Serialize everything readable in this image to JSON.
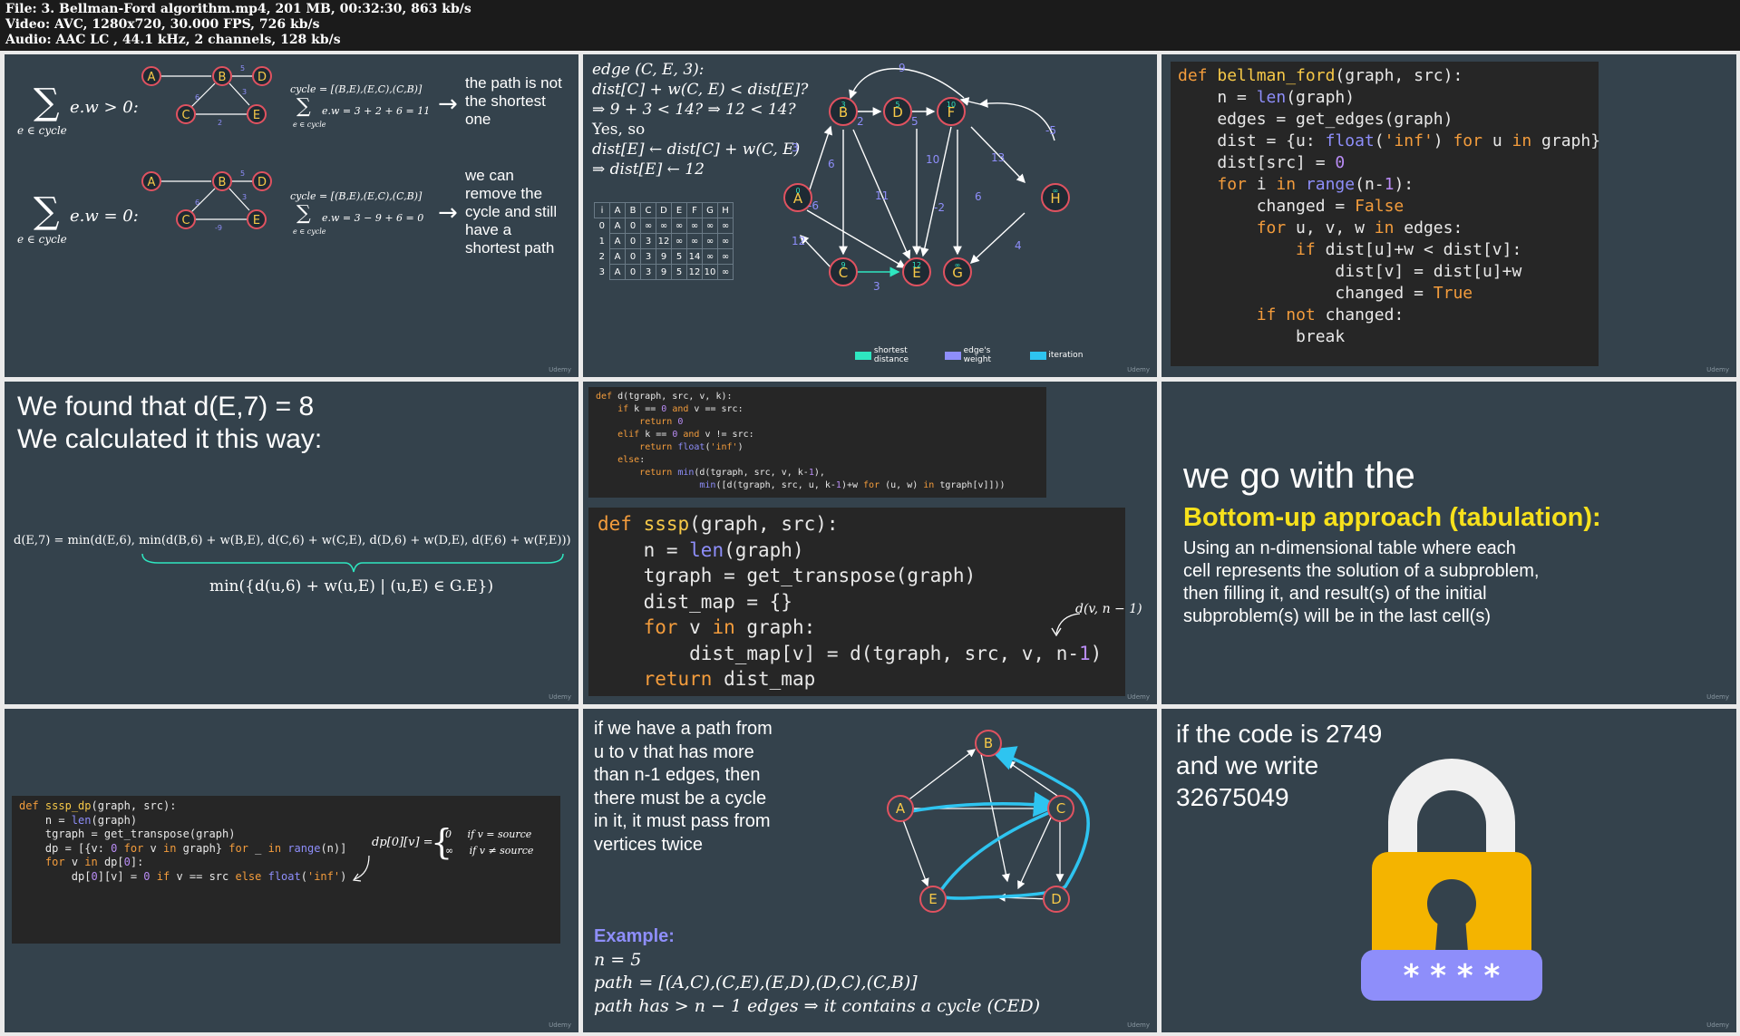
{
  "header": {
    "file": "File: 3. Bellman-Ford algorithm.mp4, 201 MB, 00:32:30, 863 kb/s",
    "video": "Video: AVC, 1280x720, 30.000 FPS, 726 kb/s",
    "audio": "Audio: AAC LC , 44.1 kHz, 2 channels, 128 kb/s"
  },
  "watermark": "Udemy",
  "p1": {
    "sum1": "e.w > 0:",
    "sum_sub": "e ∈ cycle",
    "cycle1": "cycle = [(B,E),(E,C),(C,B)]",
    "calc1": "e.w = 3 + 2 + 6 = 11",
    "text1": [
      "the path is not",
      "the shortest",
      "one"
    ],
    "sum2": "e.w = 0:",
    "cycle2": "cycle = [(B,E),(E,C),(C,B)]",
    "calc2": "e.w = 3 − 9 + 6 = 0",
    "text2": [
      "we can",
      "remove the",
      "cycle and still",
      "have a",
      "shortest path"
    ],
    "arrow": "→"
  },
  "p2": {
    "lines": [
      "edge (C, E, 3):",
      "dist[C] + w(C, E) < dist[E]?",
      "⇒ 9 + 3 < 14? ⇒ 12 < 14?",
      "Yes, so",
      "dist[E] ← dist[C] + w(C, E)",
      "⇒ dist[E] ← 12"
    ],
    "table_header": [
      "i",
      "A",
      "B",
      "C",
      "D",
      "E",
      "F",
      "G",
      "H"
    ],
    "table_rows": [
      [
        "0",
        "A",
        "0",
        "∞",
        "∞",
        "∞",
        "∞",
        "∞",
        "∞"
      ],
      [
        "1",
        "A",
        "0",
        "3",
        "12",
        "∞",
        "∞",
        "∞",
        "∞"
      ],
      [
        "2",
        "A",
        "0",
        "3",
        "9",
        "5",
        "14",
        "∞",
        "∞"
      ],
      [
        "3",
        "A",
        "0",
        "3",
        "9",
        "5",
        "12",
        "10",
        "∞"
      ]
    ],
    "legend": [
      {
        "label": "shortest distance",
        "color": "#2ee6c0"
      },
      {
        "label": "edge's weight",
        "color": "#8e8efa"
      },
      {
        "label": "iteration",
        "color": "#2ec4f0"
      }
    ],
    "nodes": [
      {
        "id": "A",
        "d": "0"
      },
      {
        "id": "B",
        "d": "3"
      },
      {
        "id": "D",
        "d": "5"
      },
      {
        "id": "F",
        "d": "10"
      },
      {
        "id": "H",
        "d": "∞"
      },
      {
        "id": "C",
        "d": "9"
      },
      {
        "id": "E",
        "d": "12"
      },
      {
        "id": "G",
        "d": "∞"
      }
    ],
    "weights": [
      "9",
      "2",
      "5",
      "-5",
      "3",
      "6",
      "10",
      "13",
      "11",
      "-2",
      "6",
      "-6",
      "12",
      "3",
      "4"
    ]
  },
  "p3": {
    "code": [
      "def bellman_ford(graph, src):",
      "    n = len(graph)",
      "    edges = get_edges(graph)",
      "    dist = {u: float('inf') for u in graph}",
      "    dist[src] = 0",
      "    for i in range(n-1):",
      "        changed = False",
      "        for u, v, w in edges:",
      "            if dist[u]+w < dist[v]:",
      "                dist[v] = dist[u]+w",
      "                changed = True",
      "        if not changed:",
      "            break"
    ]
  },
  "p4": {
    "line1": "We found that d(E,7) = 8",
    "line2": "We calculated it this way:",
    "formula": "d(E,7) = min(d(E,6), min(d(B,6) + w(B,E), d(C,6) + w(C,E), d(D,6) + w(D,E), d(F,6) + w(F,E)))",
    "brace": "min({d(u,6) + w(u,E) | (u,E) ∈ G.E})"
  },
  "p5": {
    "small_code": [
      "def d(tgraph, src, v, k):",
      "    if k == 0 and v == src:",
      "        return 0",
      "    elif k == 0 and v != src:",
      "        return float('inf')",
      "    else:",
      "        return min(d(tgraph, src, v, k-1),",
      "                   min([d(tgraph, src, u, k-1)+w for (u, w) in tgraph[v]]))"
    ],
    "big_code": [
      "def sssp(graph, src):",
      "    n = len(graph)",
      "    tgraph = get_transpose(graph)",
      "    dist_map = {}",
      "    for v in graph:",
      "        dist_map[v] = d(tgraph, src, v, n-1)",
      "    return dist_map"
    ],
    "note": "d(v, n − 1)"
  },
  "p6": {
    "line1": "we go with the",
    "line2": "Bottom-up approach (tabulation):",
    "para": [
      "Using an n-dimensional table where each",
      "cell represents the solution of a subproblem,",
      "then filling it, and result(s) of the initial",
      "subproblem(s) will be in the last cell(s)"
    ]
  },
  "p7": {
    "code": [
      "def sssp_dp(graph, src):",
      "    n = len(graph)",
      "    tgraph = get_transpose(graph)",
      "    dp = [{v: 0 for v in graph} for _ in range(n)]",
      "    for v in dp[0]:",
      "        dp[0][v] = 0 if v == src else float('inf')"
    ],
    "dp_lhs": "dp[0][v] =",
    "case1": "0     if v = source",
    "case2": "∞     if v ≠ source"
  },
  "p8": {
    "para": [
      "if we have a path from",
      "u to v that has more",
      "than n-1 edges, then",
      "there must be a cycle",
      "in it, it must pass from",
      "vertices twice"
    ],
    "example": "Example:",
    "n": "n = 5",
    "path": "path = [(A,C),(C,E),(E,D),(D,C),(C,B)]",
    "conclusion": "path has > n − 1 edges ⇒ it contains a cycle (CED)",
    "nodes": [
      "B",
      "A",
      "C",
      "E",
      "D"
    ]
  },
  "p9": {
    "line1": "if the code is 2749",
    "line2": "and we write",
    "line3": "32675049",
    "stars": "* * * *",
    "lock_color": "#f4b400",
    "shackle_color": "#f0f0f0",
    "pad_color": "#8e8efa"
  }
}
